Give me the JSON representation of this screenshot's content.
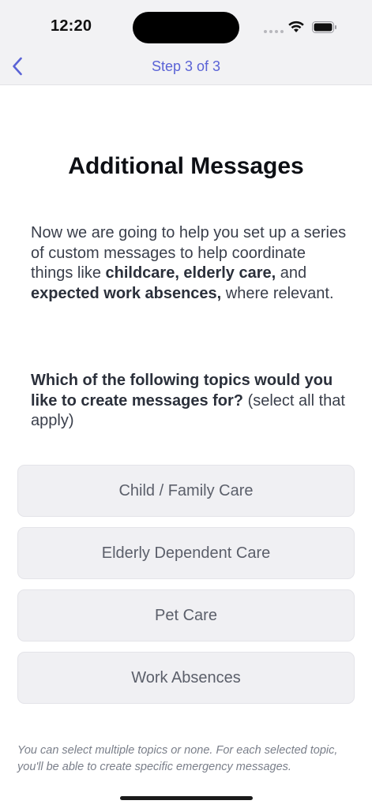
{
  "status_bar": {
    "time": "12:20",
    "icons": [
      "signal-dots-icon",
      "wifi-icon",
      "battery-icon"
    ]
  },
  "nav": {
    "title": "Step 3 of 3",
    "back_icon": "chevron-left-icon",
    "accent_color": "#5a63d6"
  },
  "page": {
    "title": "Additional Messages",
    "intro": {
      "part1": "Now we are going to help you set up a series of custom messages to help coordinate things like ",
      "bold1": "childcare, elderly care,",
      "part2": " and ",
      "bold2": "expected work absences,",
      "part3": " where relevant."
    },
    "question": {
      "bold": "Which of the following topics would you like to create messages for?",
      "rest": " (select all that apply)"
    },
    "topics": [
      {
        "label": "Child / Family Care"
      },
      {
        "label": "Elderly Dependent Care"
      },
      {
        "label": "Pet Care"
      },
      {
        "label": "Work Absences"
      }
    ],
    "footnote": "You can select multiple topics or none. For each selected topic, you'll be able to create specific emergency messages."
  }
}
